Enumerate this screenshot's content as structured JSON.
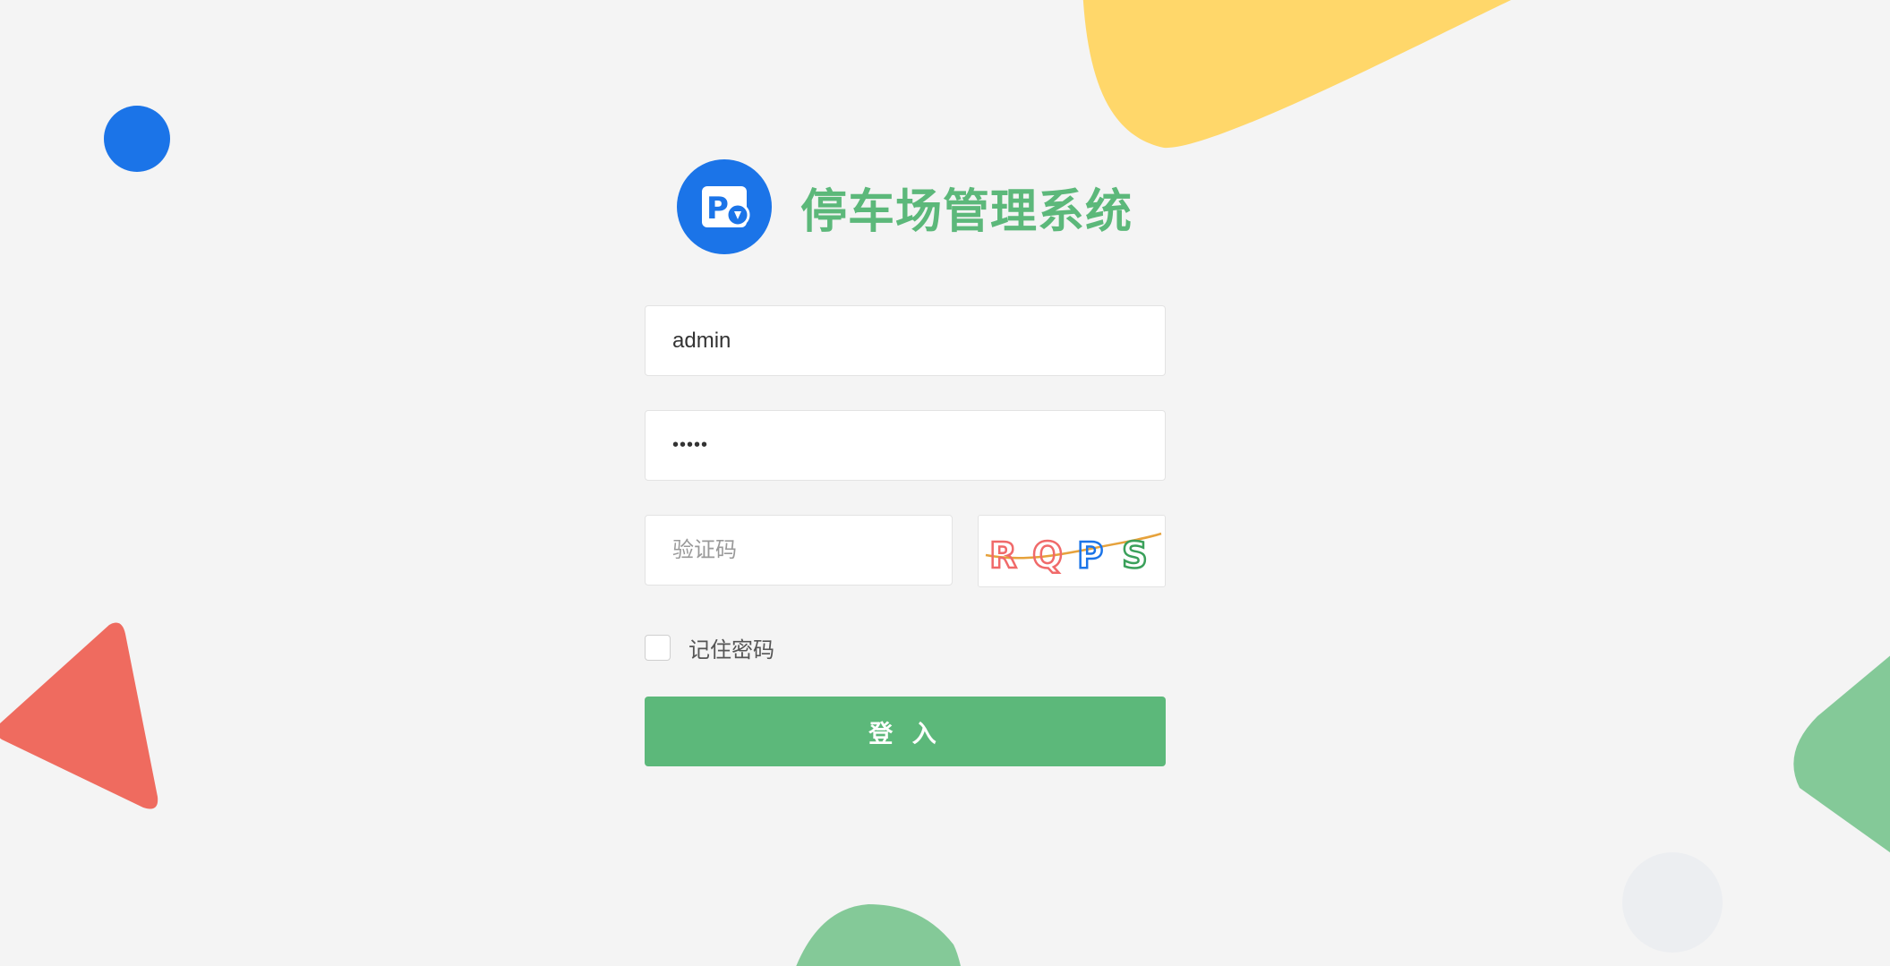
{
  "app": {
    "title": "停车场管理系统",
    "logo_icon": "parking-lot-icon",
    "brand_color": "#1b74e8",
    "title_color": "#5cb87a"
  },
  "login_form": {
    "username": {
      "value": "admin",
      "placeholder": ""
    },
    "password": {
      "value": "•••••",
      "placeholder": ""
    },
    "captcha": {
      "placeholder": "验证码",
      "value": "",
      "image_text": [
        "R",
        "Q",
        "P",
        "S"
      ],
      "image_colors": [
        "#f06a6a",
        "#f06a6a",
        "#1b74e8",
        "#3aa05a"
      ]
    },
    "remember_label": "记住密码",
    "remember_checked": false,
    "submit_label": "登 入",
    "submit_color": "#5cb87a"
  },
  "background": {
    "colors": {
      "page": "#f4f4f4",
      "yellow": "#ffd76a",
      "red": "#ef6b5f",
      "green": "#84c998",
      "blue": "#1b74e8",
      "grey": "#eceef1"
    }
  }
}
